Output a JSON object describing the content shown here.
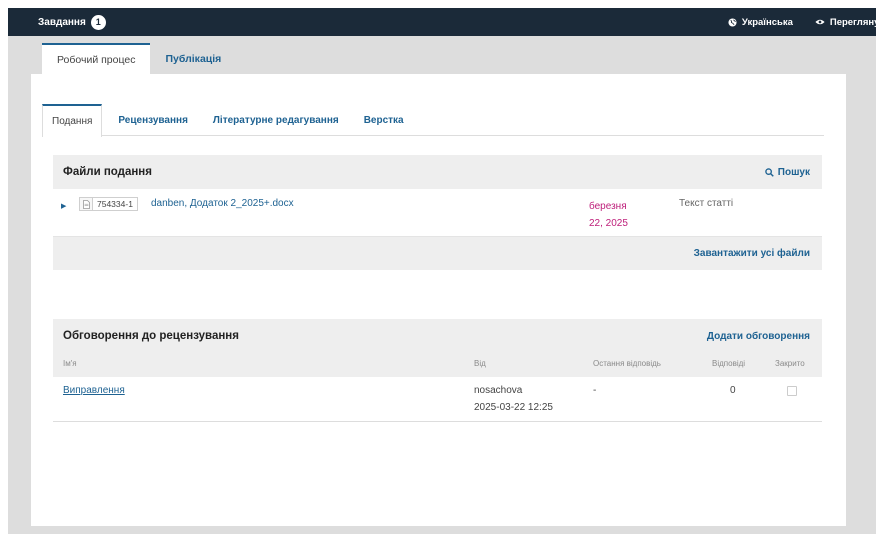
{
  "topbar": {
    "tasks_label": "Завдання",
    "tasks_count": "1",
    "language_label": "Українська",
    "view_label": "Переглянути"
  },
  "main_tabs": [
    {
      "label": "Робочий процес",
      "active": true
    },
    {
      "label": "Публікація",
      "active": false
    }
  ],
  "sub_tabs": [
    {
      "label": "Подання",
      "active": true
    },
    {
      "label": "Рецензування",
      "active": false
    },
    {
      "label": "Літературне редагування",
      "active": false
    },
    {
      "label": "Верстка",
      "active": false
    }
  ],
  "submission_files": {
    "title": "Файли подання",
    "search_label": "Пошук",
    "files": [
      {
        "id": "754334-1",
        "name": "danben, Додаток 2_2025+.docx",
        "date_line1": "березня",
        "date_line2": "22, 2025",
        "type": "Текст статті"
      }
    ],
    "download_all_label": "Завантажити усі файли"
  },
  "discussions": {
    "title": "Обговорення до рецензування",
    "add_label": "Додати обговорення",
    "columns": {
      "name": "Ім'я",
      "from": "Від",
      "last_reply": "Остання відповідь",
      "replies": "Відповіді",
      "closed": "Закрито"
    },
    "rows": [
      {
        "name": "Виправлення",
        "from_user": "nosachova",
        "from_date": "2025-03-22 12:25",
        "last_reply": "-",
        "replies": "0",
        "closed": false
      }
    ]
  },
  "colors": {
    "topbar_bg": "#1b2a39",
    "link": "#1e6292",
    "date": "#be1e7a",
    "page_bg": "#dddddd"
  }
}
